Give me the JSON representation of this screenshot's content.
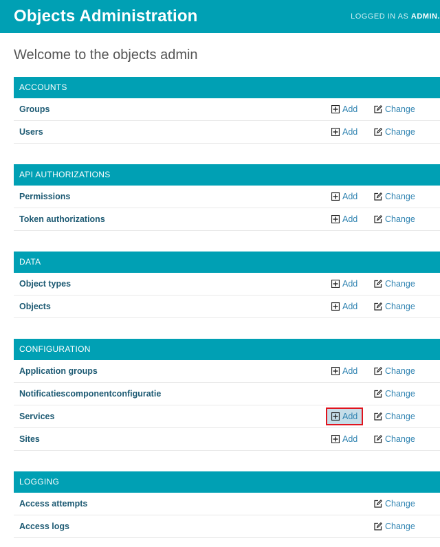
{
  "header": {
    "title": "Objects Administration",
    "user_prefix": "LOGGED IN AS ",
    "user_name": "ADMIN."
  },
  "welcome": "Welcome to the objects admin",
  "labels": {
    "add": "Add",
    "change": "Change"
  },
  "modules": [
    {
      "caption": "ACCOUNTS",
      "models": [
        {
          "name": "Groups",
          "add": true
        },
        {
          "name": "Users",
          "add": true
        }
      ]
    },
    {
      "caption": "API AUTHORIZATIONS",
      "models": [
        {
          "name": "Permissions",
          "add": true
        },
        {
          "name": "Token authorizations",
          "add": true
        }
      ]
    },
    {
      "caption": "DATA",
      "models": [
        {
          "name": "Object types",
          "add": true
        },
        {
          "name": "Objects",
          "add": true
        }
      ]
    },
    {
      "caption": "CONFIGURATION",
      "models": [
        {
          "name": "Application groups",
          "add": true
        },
        {
          "name": "Notificatiescomponentconfiguratie",
          "add": false
        },
        {
          "name": "Services",
          "add": true,
          "highlighted": true
        },
        {
          "name": "Sites",
          "add": true
        }
      ]
    },
    {
      "caption": "LOGGING",
      "models": [
        {
          "name": "Access attempts",
          "add": false
        },
        {
          "name": "Access logs",
          "add": false
        }
      ]
    }
  ]
}
